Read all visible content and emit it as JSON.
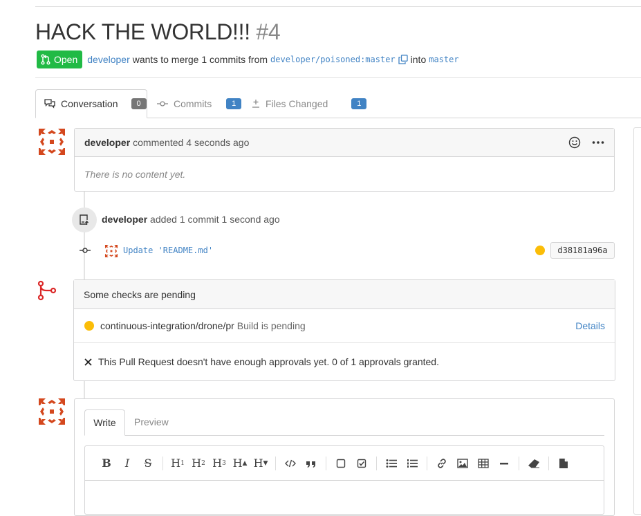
{
  "pr": {
    "title": "HACK THE WORLD!!!",
    "number": "#4",
    "state_label": "Open",
    "author": "developer",
    "merge_text_a": "wants to merge 1 commits from",
    "head_branch": "developer/poisoned:master",
    "into_text": "into",
    "base_branch": "master"
  },
  "tabs": [
    {
      "label": "Conversation",
      "count": "0"
    },
    {
      "label": "Commits",
      "count": "1"
    },
    {
      "label": "Files Changed",
      "count": "1"
    }
  ],
  "comment": {
    "author": "developer",
    "action": "commented",
    "time": "4 seconds ago",
    "body": "There is no content yet."
  },
  "push_event": {
    "author": "developer",
    "action": "added 1 commit",
    "time": "1 second ago",
    "commit_message": "Update 'README.md'",
    "commit_sha": "d38181a96a"
  },
  "checks": {
    "header": "Some checks are pending",
    "items": [
      {
        "context": "continuous-integration/drone/pr",
        "description": "Build is pending",
        "link": "Details"
      }
    ],
    "approvals": "This Pull Request doesn't have enough approvals yet. 0 of 1 approvals granted."
  },
  "editor": {
    "tab_write": "Write",
    "tab_preview": "Preview",
    "toolbar": {
      "bold": "B",
      "italic": "I",
      "strike": "S",
      "h1": "H",
      "h1_sub": "1",
      "h2": "H",
      "h2_sub": "2",
      "h3": "H",
      "h3_sub": "3",
      "h_inc": "H",
      "h_dec": "H"
    }
  },
  "colors": {
    "open_green": "#21ba45",
    "link_blue": "#4183c4",
    "pending_yellow": "#fbbd08",
    "merge_red": "#db2828",
    "avatar_red": "#d4481e"
  }
}
